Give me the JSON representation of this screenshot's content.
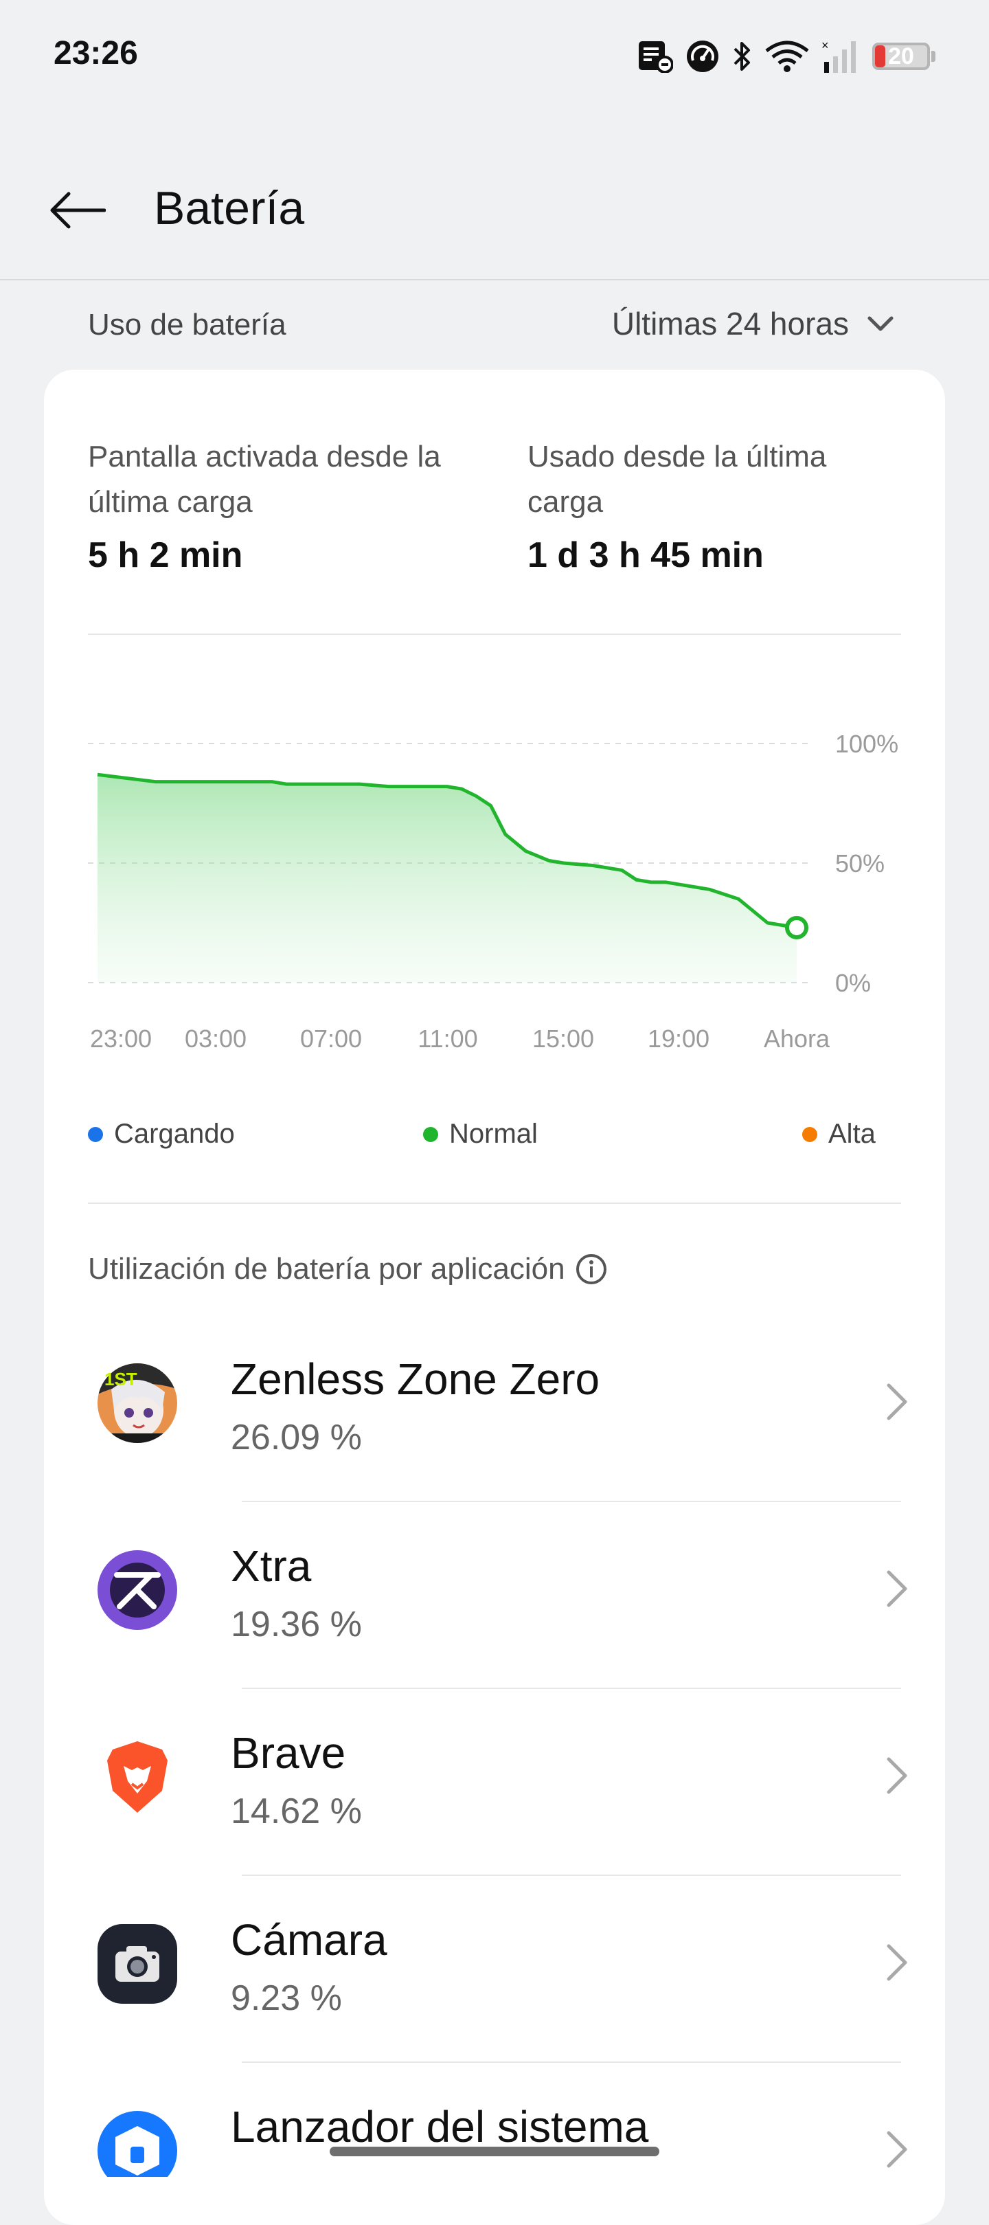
{
  "status_bar": {
    "time": "23:26",
    "battery_level": "20",
    "battery_fraction": 0.2,
    "icons": [
      "message-icon",
      "speedometer-icon",
      "bluetooth-icon",
      "wifi-icon",
      "signal-icon",
      "battery-icon"
    ]
  },
  "header": {
    "title": "Batería"
  },
  "usage": {
    "label": "Uso de batería",
    "range": "Últimas 24 horas"
  },
  "stats": {
    "screen_on_label": "Pantalla activada desde la última carga",
    "screen_on_value": "5 h 2 min",
    "used_label": "Usado desde la última carga",
    "used_value": "1 d 3 h 45 min"
  },
  "chart_data": {
    "type": "area",
    "title": "",
    "x_ticks": [
      "23:00",
      "03:00",
      "07:00",
      "11:00",
      "15:00",
      "19:00",
      "Ahora"
    ],
    "y_ticks": [
      "100%",
      "50%",
      "0%"
    ],
    "ylim": [
      0,
      100
    ],
    "grid": true,
    "series": [
      {
        "name": "Normal",
        "color": "#21b52e",
        "x_hours": [
          0,
          2,
          4,
          6,
          6.5,
          8,
          9,
          10,
          12,
          12.5,
          13,
          13.5,
          14,
          14.7,
          15.5,
          16,
          17,
          18,
          18.5,
          19,
          19.5,
          20,
          21,
          22,
          23,
          24
        ],
        "values": [
          87,
          84,
          84,
          84,
          83,
          83,
          83,
          82,
          82,
          81,
          78,
          74,
          62,
          55,
          51,
          50,
          49,
          47,
          43,
          42,
          42,
          41,
          39,
          35,
          25,
          23
        ]
      }
    ]
  },
  "legend": [
    {
      "label": "Cargando",
      "color": "#1a73e8"
    },
    {
      "label": "Normal",
      "color": "#21b52e"
    },
    {
      "label": "Alta",
      "color": "#f57c00"
    }
  ],
  "apps_section": {
    "title": "Utilización de batería por aplicación"
  },
  "apps": [
    {
      "name": "Zenless Zone Zero",
      "percent": "26.09 %",
      "icon": "zenless-zone-zero-icon",
      "badge": "1ST"
    },
    {
      "name": "Xtra",
      "percent": "19.36 %",
      "icon": "xtra-icon"
    },
    {
      "name": "Brave",
      "percent": "14.62 %",
      "icon": "brave-icon"
    },
    {
      "name": "Cámara",
      "percent": "9.23 %",
      "icon": "camera-icon"
    },
    {
      "name": "Lanzador del sistema",
      "percent": "",
      "icon": "system-launcher-icon"
    }
  ]
}
